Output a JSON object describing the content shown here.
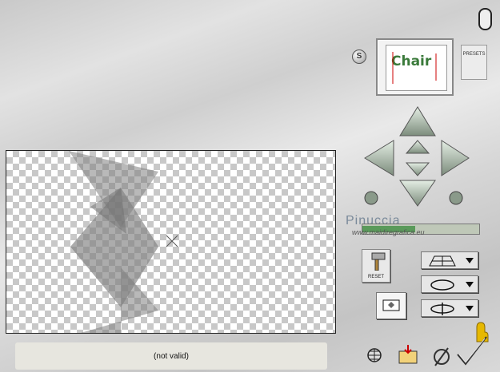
{
  "status": {
    "text": "(not valid)"
  },
  "presets": {
    "label": "PRESETS"
  },
  "s_button": {
    "label": "S"
  },
  "thumbnail": {
    "text": "Chair"
  },
  "reset": {
    "label": "RESET"
  },
  "watermark": {
    "name": "Pinuccia",
    "url": "www.maidiregrafica.eu"
  },
  "slider": {
    "value": 0.45
  }
}
